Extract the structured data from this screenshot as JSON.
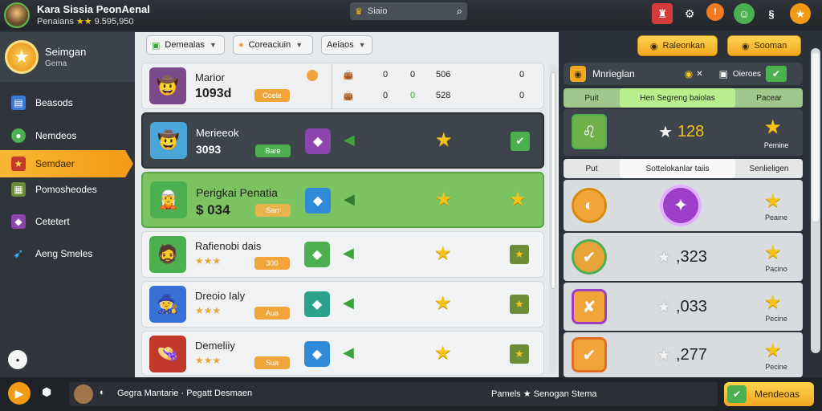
{
  "header": {
    "title": "Kara Sissia PeonAenal",
    "subtitle": "Penaians",
    "subtitle_stars": "★★",
    "subtitle_extra": "9.595,950",
    "search_label": "Siaio"
  },
  "sidebar": {
    "profile_name": "Seimgan",
    "profile_sub": "Gema",
    "items": [
      {
        "label": "Beasods",
        "icon": "book-icon"
      },
      {
        "label": "Nemdeos",
        "icon": "gamepad-icon"
      },
      {
        "label": "Semdaer",
        "icon": "star-icon"
      },
      {
        "label": "Pomosheodes",
        "icon": "map-icon"
      },
      {
        "label": "Cetetert",
        "icon": "gem-icon"
      },
      {
        "label": "Aeng Smeles",
        "icon": "bolt-icon"
      }
    ]
  },
  "filters": [
    "Demealas",
    "Coreaciuin",
    "Aeiaos"
  ],
  "list_header": {
    "name": "Marior",
    "value": "1093d",
    "pill": "Coele",
    "cols": [
      [
        "0",
        "0",
        "506",
        "0"
      ],
      [
        "0",
        "0",
        "528",
        "0"
      ]
    ]
  },
  "rows": [
    {
      "name": "Merieeok",
      "value": "3093",
      "pill": "Bare"
    },
    {
      "name": "Perigkai Penatia",
      "value": "$ 034",
      "pill": "Sarr"
    },
    {
      "name": "Rafienobi dais",
      "value": "★★★",
      "pill": "300"
    },
    {
      "name": "Dreoio Ialy",
      "value": "★★★",
      "pill": "Aua"
    },
    {
      "name": "Demeliiy",
      "value": "★★★",
      "pill": "Sua"
    }
  ],
  "right_panel": {
    "btn1": "Raleonkan",
    "btn2": "Sooman",
    "head_title": "Mnrieglan",
    "head_extra": "Oieroes",
    "tabs1": [
      "Puit",
      "Hen Segreng baiolas",
      "Pacear"
    ],
    "tabs2": [
      "Put",
      "Sottelokanlar taiis",
      "Senlieligen"
    ],
    "top_value": "128",
    "top_label": "Pemine",
    "rows": [
      {
        "value": "",
        "label": "Peaine"
      },
      {
        "value": ",323",
        "label": "Pacino"
      },
      {
        "value": ",033",
        "label": "Pecine"
      },
      {
        "value": ",277",
        "label": "Pecine"
      }
    ]
  },
  "bottom": {
    "chat_text": "Gegra Mantarie · Pegatt Desmaen",
    "status_text": "Pamels ★ Senogan Stema",
    "action_button": "Mendeoas"
  },
  "colors": {
    "accent_orange": "#f2a91f",
    "accent_green": "#5dbb4b",
    "star": "#f6c31a"
  }
}
